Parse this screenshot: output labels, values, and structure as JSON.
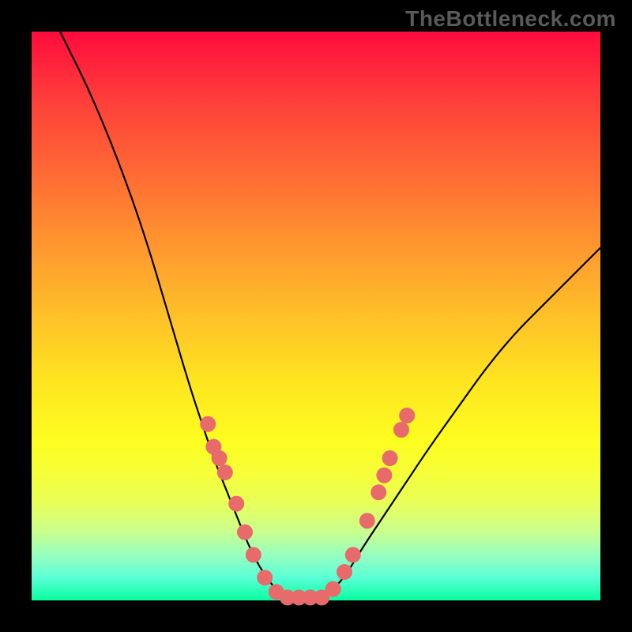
{
  "watermark": "TheBottleneck.com",
  "chart_data": {
    "type": "line",
    "title": "",
    "xlabel": "",
    "ylabel": "",
    "xlim": [
      0,
      100
    ],
    "ylim": [
      0,
      100
    ],
    "bands_from_top": [
      {
        "color": "#ff0b3d",
        "meaning": "severe-bottleneck"
      },
      {
        "color": "#ff9530",
        "meaning": "high-bottleneck"
      },
      {
        "color": "#ffe620",
        "meaning": "moderate-bottleneck"
      },
      {
        "color": "#08ffa0",
        "meaning": "balanced"
      }
    ],
    "series": [
      {
        "name": "bottleneck-curve",
        "x": [
          5,
          10,
          15,
          20,
          25,
          28,
          30,
          32,
          34,
          36,
          38,
          40,
          42,
          44,
          46,
          48,
          50,
          52,
          55,
          58,
          62,
          66,
          70,
          75,
          80,
          85,
          90,
          95,
          100
        ],
        "y": [
          100,
          90,
          78,
          64,
          47,
          37,
          31,
          25,
          20,
          15,
          10,
          6,
          3,
          1,
          0,
          0,
          0,
          1,
          4,
          9,
          15,
          21,
          27,
          34,
          41,
          47,
          52,
          57,
          62
        ]
      }
    ],
    "marker_points": [
      {
        "x": 31,
        "y": 31
      },
      {
        "x": 32,
        "y": 27
      },
      {
        "x": 33,
        "y": 25
      },
      {
        "x": 34,
        "y": 22.5
      },
      {
        "x": 36,
        "y": 17
      },
      {
        "x": 37.5,
        "y": 12
      },
      {
        "x": 39,
        "y": 8
      },
      {
        "x": 41,
        "y": 4
      },
      {
        "x": 43,
        "y": 1.5
      },
      {
        "x": 45,
        "y": 0.5
      },
      {
        "x": 47,
        "y": 0.5
      },
      {
        "x": 49,
        "y": 0.5
      },
      {
        "x": 51,
        "y": 0.5
      },
      {
        "x": 53,
        "y": 2
      },
      {
        "x": 55,
        "y": 5
      },
      {
        "x": 56.5,
        "y": 8
      },
      {
        "x": 59,
        "y": 14
      },
      {
        "x": 61,
        "y": 19
      },
      {
        "x": 62,
        "y": 22
      },
      {
        "x": 63,
        "y": 25
      },
      {
        "x": 65,
        "y": 30
      },
      {
        "x": 66,
        "y": 32.5
      }
    ],
    "marker_style": {
      "fill": "#e86a6a",
      "radius_px": 10
    }
  }
}
